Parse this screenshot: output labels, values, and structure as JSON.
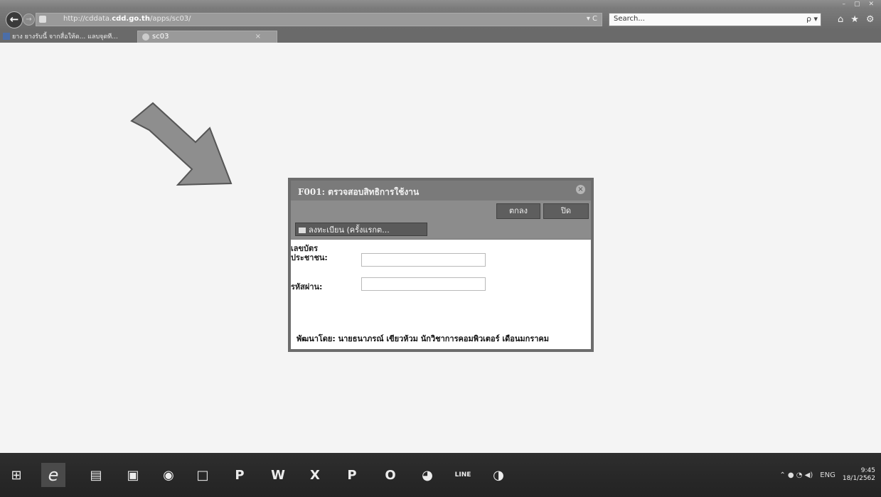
{
  "window": {
    "controls": [
      "–",
      "▢",
      "✕"
    ]
  },
  "browser": {
    "back_icon": "back-arrow-icon",
    "address_prefix": "http://cddata.",
    "address_domain": "cdd.go.th",
    "address_path": "/apps/sc03/",
    "address_actions": "▾ C",
    "search_placeholder": "Search...",
    "search_icon": "ρ ▾",
    "toolbar_icons": [
      "⌂",
      "★",
      "⚙"
    ]
  },
  "tabs": {
    "favorite_label": "ยาง ยางรับนี้ จากสื่อให้ด... แลบจุดที...",
    "active_tab_label": "sc03",
    "active_tab_close": "×"
  },
  "dialog": {
    "title": "F001: ตรวจสอบสิทธิการใช้งาน",
    "close_icon": "×",
    "ok_label": "ตกลง",
    "close_label": "ปิด",
    "register_label": "ลงทะเบียน (ครั้งแรกต...",
    "citizen_id_label_line1": "เลขบัตร",
    "citizen_id_label_line2": "ประชาชน:",
    "citizen_id_value": "",
    "password_label": "รหัสผ่าน:",
    "password_value": "",
    "footer": "พัฒนาโดย: นายธนาภรณ์ เขียวห้วม นักวิชาการคอมพิวเตอร์ เดือนมกราคม"
  },
  "taskbar": {
    "items": [
      {
        "name": "start-button",
        "glyph": "⊞"
      },
      {
        "name": "internet-explorer",
        "glyph": "e"
      },
      {
        "name": "file-explorer",
        "glyph": "▤"
      },
      {
        "name": "store",
        "glyph": "▣"
      },
      {
        "name": "chrome",
        "glyph": "◉"
      },
      {
        "name": "window-app",
        "glyph": "□"
      },
      {
        "name": "powerpoint",
        "glyph": "P"
      },
      {
        "name": "word",
        "glyph": "W"
      },
      {
        "name": "excel",
        "glyph": "X"
      },
      {
        "name": "publisher",
        "glyph": "P"
      },
      {
        "name": "outlook",
        "glyph": "O"
      },
      {
        "name": "camera-app",
        "glyph": "◕"
      },
      {
        "name": "line-app",
        "glyph": "LINE"
      },
      {
        "name": "media-app",
        "glyph": "◑"
      }
    ],
    "tray_icons": "⌃ ● ◔ ◀)",
    "language": "ENG",
    "time": "9:45",
    "date": "18/1/2562"
  }
}
